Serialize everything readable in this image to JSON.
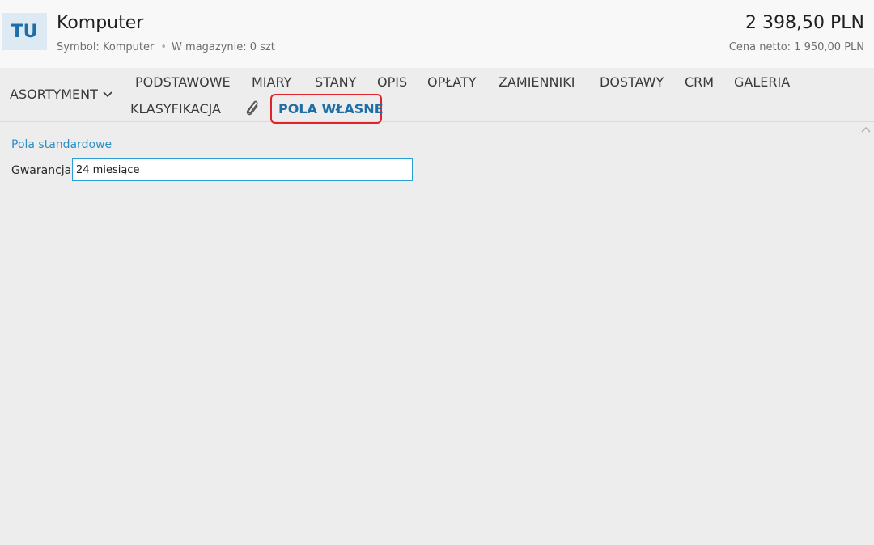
{
  "header": {
    "avatar_initials": "TU",
    "title": "Komputer",
    "symbol": "Symbol: Komputer",
    "stock": "W magazynie: 0 szt",
    "price": "2 398,50 PLN",
    "net_price": "Cena netto: 1 950,00 PLN"
  },
  "tabs": {
    "menu_label": "ASORTYMENT",
    "items": [
      {
        "label": "PODSTAWOWE"
      },
      {
        "label": "MIARY"
      },
      {
        "label": "STANY"
      },
      {
        "label": "OPIS"
      },
      {
        "label": "OPŁATY"
      },
      {
        "label": "ZAMIENNIKI"
      },
      {
        "label": "DOSTAWY"
      },
      {
        "label": "CRM"
      },
      {
        "label": "GALERIA"
      },
      {
        "label": "KLASYFIKACJA"
      },
      {
        "label": "POLA WŁASNE"
      }
    ],
    "active": "POLA WŁASNE"
  },
  "icons": {
    "menu_chevron": "chevron-down-icon",
    "attachments": "paperclip-icon",
    "collapse": "chevron-up-icon"
  },
  "colors": {
    "accent": "#1e6fa8",
    "section_title": "#2a8fc4",
    "highlight_border": "#e0242c",
    "input_border": "#2a9fd8"
  },
  "content": {
    "section_title": "Pola standardowe",
    "fields": [
      {
        "label": "Gwarancja:",
        "value": "24 miesiące"
      }
    ]
  }
}
